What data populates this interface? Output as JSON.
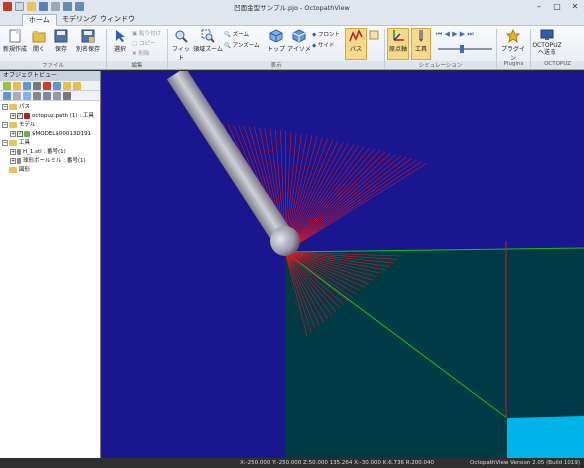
{
  "window": {
    "title": "凹面金型サンプル.pjo - OctopathView"
  },
  "tabs": [
    "ホーム",
    "モデリング",
    "ウィンドウ"
  ],
  "ribbon": {
    "file": {
      "new": "新規作成",
      "open": "開く",
      "save": "保存",
      "save_as": "別名保存",
      "group": "ファイル"
    },
    "edit": {
      "select": "選択",
      "paste": "貼り付け",
      "copy": "コピー",
      "delete": "削除",
      "group": "編集"
    },
    "view": {
      "fit": "フィット",
      "area_zoom": "領域ズーム",
      "zoom": "ズーム",
      "unzoom": "アンズーム",
      "top": "トップ",
      "iso": "アイソメ",
      "front": "フロント",
      "side": "サイド",
      "path": "パス",
      "group": "表示"
    },
    "simulation": {
      "origin_axis": "原点軸",
      "tool": "工具",
      "group": "シミュレーション"
    },
    "plugin": {
      "plugin": "プラグイン",
      "group": "Plugins"
    },
    "octopuz": {
      "send": "OCTOPUZ へ送る",
      "group": "OCTOPUZ"
    }
  },
  "object_view": {
    "title": "オブジェクトビュー",
    "tree": [
      {
        "label": "パス",
        "level": 0,
        "kind": "folder"
      },
      {
        "label": "octopuz.path (1) : 工具",
        "level": 1,
        "kind": "item"
      },
      {
        "label": "モデル",
        "level": 0,
        "kind": "folder"
      },
      {
        "label": "$MODEL$00013D191",
        "level": 1,
        "kind": "item"
      },
      {
        "label": "工具",
        "level": 0,
        "kind": "folder"
      },
      {
        "label": "H_1.stl : 番号(1)",
        "level": 1,
        "kind": "tool"
      },
      {
        "label": "球形ボールミル : 番号(1)",
        "level": 1,
        "kind": "tool"
      },
      {
        "label": "図形",
        "level": 0,
        "kind": "folder"
      }
    ]
  },
  "status": {
    "coords": "X:-250.000 Y:-250.000 Z:50.000 135.264 X:-30.000 K:6.736 R:200.040",
    "version": "OctopathView Version 2.05 (Build 1019)"
  },
  "colors": {
    "background": "#1a168f",
    "workpiece": "#003a45",
    "toolpath": "#d01a2a",
    "accent_edge": "#19c01a"
  }
}
